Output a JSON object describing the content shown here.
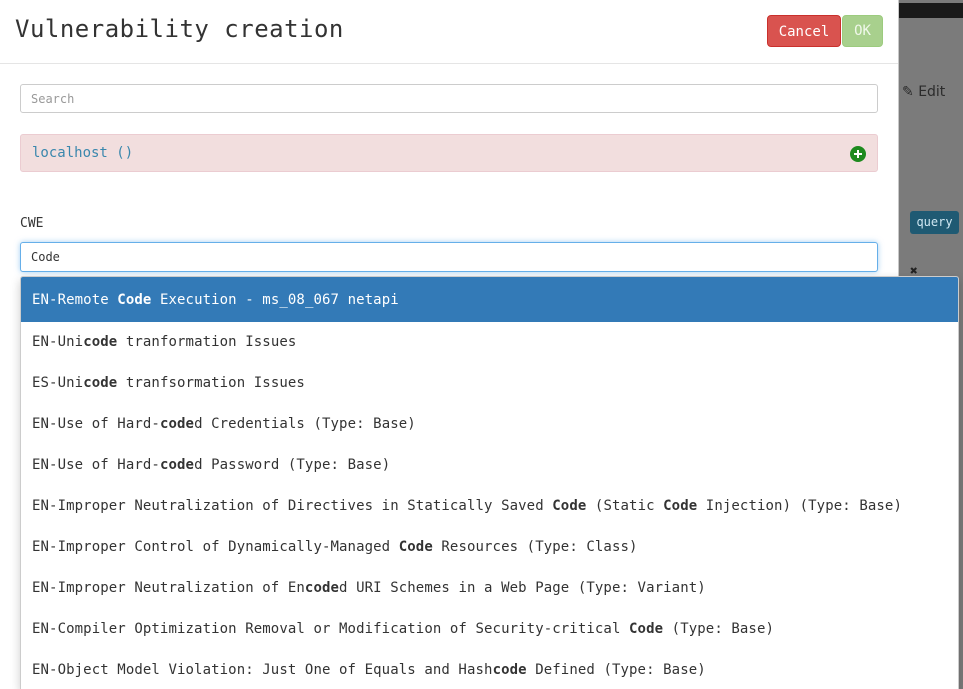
{
  "modal": {
    "title": "Vulnerability creation",
    "cancel_label": "Cancel",
    "ok_label": "OK"
  },
  "search": {
    "placeholder": "Search",
    "value": ""
  },
  "host": {
    "label": "localhost ()"
  },
  "cwe": {
    "label": "CWE",
    "value": "Code"
  },
  "background": {
    "edit_label": "Edit",
    "query_label": "query",
    "x_label": "✖"
  },
  "suggestions": [
    {
      "parts": [
        "EN-Remote ",
        "Code",
        " Execution - ms_08_067 netapi"
      ]
    },
    {
      "parts": [
        "EN-Uni",
        "code",
        " tranformation Issues"
      ]
    },
    {
      "parts": [
        "ES-Uni",
        "code",
        " tranfsormation Issues"
      ]
    },
    {
      "parts": [
        "EN-Use of Hard-",
        "code",
        "d Credentials (Type: Base)"
      ]
    },
    {
      "parts": [
        "EN-Use of Hard-",
        "code",
        "d Password (Type: Base)"
      ]
    },
    {
      "parts": [
        "EN-Improper Neutralization of Directives in Statically Saved ",
        "Code",
        " (Static ",
        "Code",
        " Injection) (Type: Base)"
      ]
    },
    {
      "parts": [
        "EN-Improper Control of Dynamically-Managed ",
        "Code",
        " Resources (Type: Class)"
      ]
    },
    {
      "parts": [
        "EN-Improper Neutralization of En",
        "code",
        "d URI Schemes in a Web Page (Type: Variant)"
      ]
    },
    {
      "parts": [
        "EN-Compiler Optimization Removal or Modification of Security-critical ",
        "Code",
        " (Type: Base)"
      ]
    },
    {
      "parts": [
        "EN-Object Model Violation: Just One of Equals and Hash",
        "code",
        " Defined (Type: Base)"
      ]
    }
  ],
  "colors": {
    "cancel": "#d9534f",
    "ok": "#a8d08d",
    "host_bg": "#f2dede",
    "active_item": "#337ab7",
    "plus": "#1e8a1e"
  }
}
